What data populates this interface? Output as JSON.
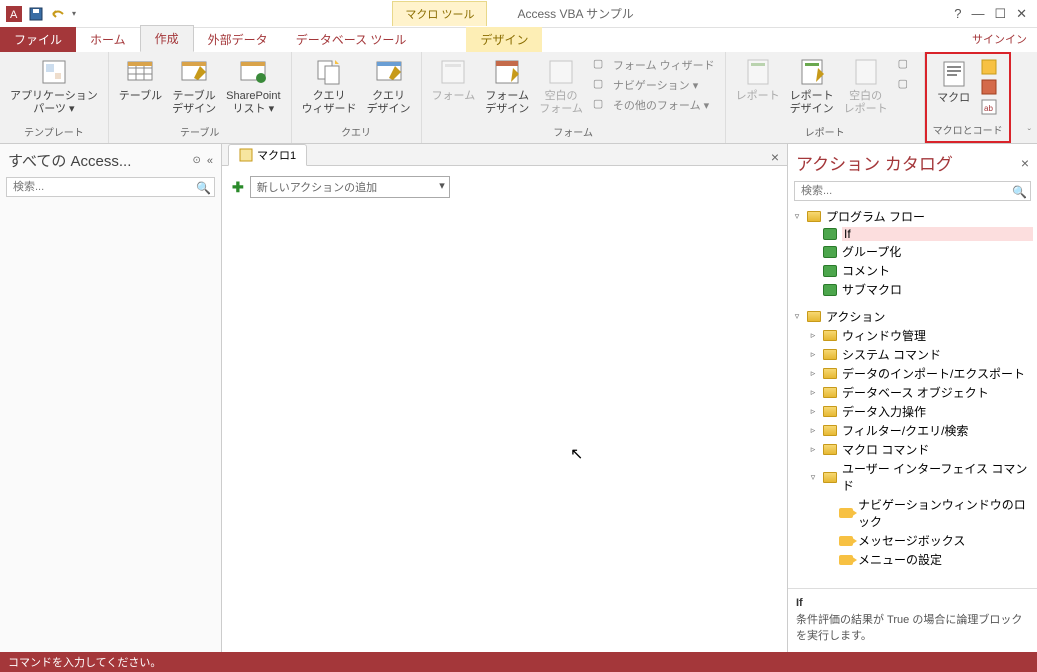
{
  "qat": {
    "app_icon": "A"
  },
  "title": {
    "context_tab": "マクロ ツール",
    "app_title": "Access VBA サンプル"
  },
  "win": {
    "help": "?",
    "min": "—",
    "max": "☐",
    "close": "✕",
    "signin": "サインイン"
  },
  "tabs": {
    "file": "ファイル",
    "home": "ホーム",
    "create": "作成",
    "external": "外部データ",
    "dbtools": "データベース ツール",
    "design": "デザイン"
  },
  "ribbon": {
    "templates": {
      "app_parts": "アプリケーション\nパーツ ▾",
      "label": "テンプレート"
    },
    "tables": {
      "table": "テーブル",
      "table_design": "テーブル\nデザイン",
      "sharepoint": "SharePoint\nリスト ▾",
      "label": "テーブル"
    },
    "queries": {
      "wizard": "クエリ\nウィザード",
      "design": "クエリ\nデザイン",
      "label": "クエリ"
    },
    "forms": {
      "form": "フォーム",
      "form_design": "フォーム\nデザイン",
      "blank": "空白の\nフォーム",
      "s1": "フォーム ウィザード",
      "s2": "ナビゲーション ▾",
      "s3": "その他のフォーム ▾",
      "label": "フォーム"
    },
    "reports": {
      "report": "レポート",
      "report_design": "レポート\nデザイン",
      "blank": "空白の\nレポート",
      "label": "レポート"
    },
    "macro": {
      "macro": "マクロ",
      "label": "マクロとコード"
    }
  },
  "nav": {
    "title": "すべての Access...",
    "search_ph": "検索..."
  },
  "doc": {
    "tab1": "マクロ1",
    "add_action_ph": "新しいアクションの追加"
  },
  "catalog": {
    "title": "アクション カタログ",
    "search_ph": "検索...",
    "g1": "プログラム フロー",
    "g1_items": [
      "If",
      "グループ化",
      "コメント",
      "サブマクロ"
    ],
    "g2": "アクション",
    "g2_items": [
      "ウィンドウ管理",
      "システム コマンド",
      "データのインポート/エクスポート",
      "データベース オブジェクト",
      "データ入力操作",
      "フィルター/クエリ/検索",
      "マクロ コマンド"
    ],
    "g2_ui": "ユーザー インターフェイス コマンド",
    "g2_ui_items": [
      "ナビゲーションウィンドウのロック",
      "メッセージボックス",
      "メニューの設定"
    ],
    "desc_title": "If",
    "desc_body": "条件評価の結果が True の場合に論理ブロックを実行します。"
  },
  "status": {
    "text": "コマンドを入力してください。"
  }
}
